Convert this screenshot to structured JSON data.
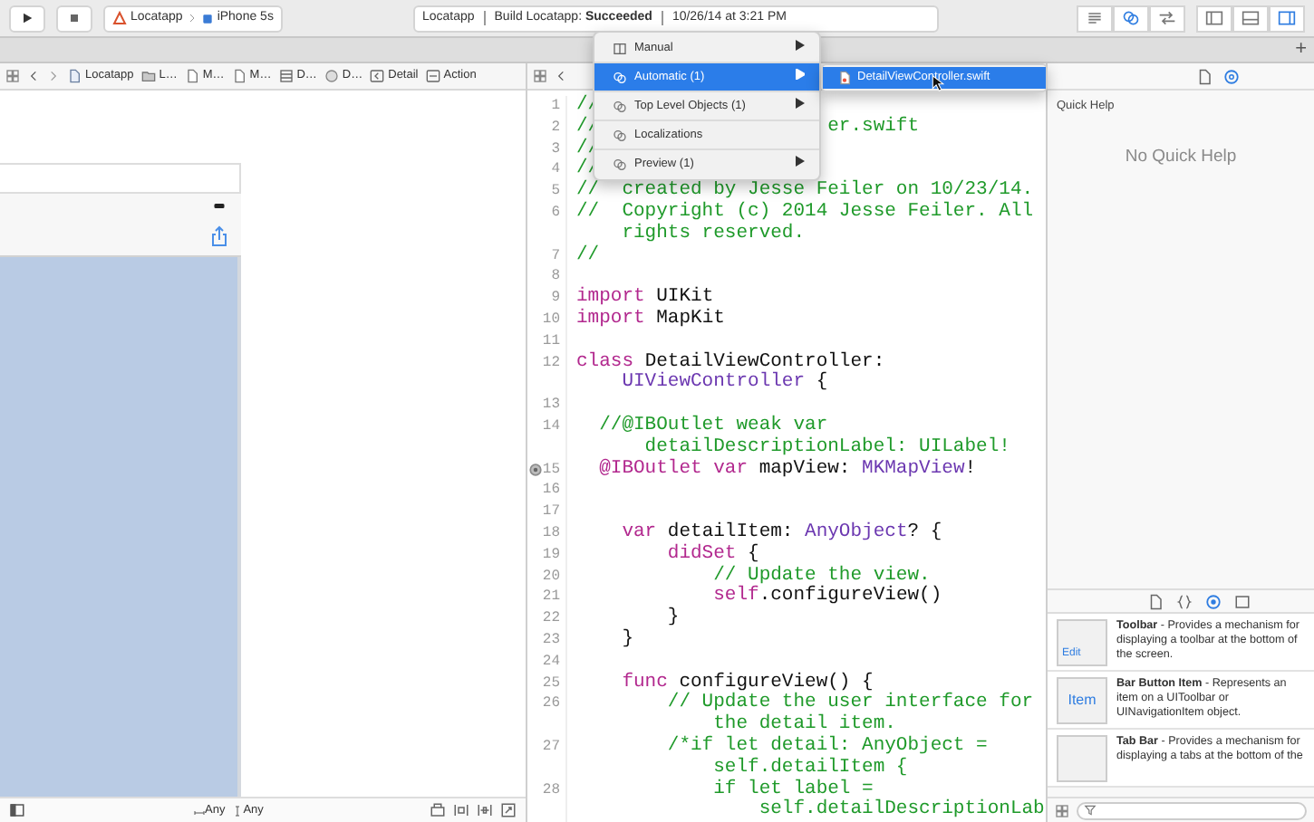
{
  "toolbar": {
    "scheme": {
      "project": "Locatapp",
      "device": "iPhone 5s"
    },
    "activity": {
      "project": "Locatapp",
      "build": "Build Locatapp: **Succeeded**",
      "timestamp": "10/26/14 at 3:21 PM"
    },
    "editor_modes": [
      {
        "kind": "standard",
        "selected": false
      },
      {
        "kind": "assistant",
        "selected": true
      },
      {
        "kind": "version",
        "selected": false
      }
    ],
    "panels": [
      {
        "kind": "navigator",
        "selected": false
      },
      {
        "kind": "debug",
        "selected": false
      },
      {
        "kind": "utilities",
        "selected": true
      }
    ]
  },
  "tab_bar": {
    "add_button": "+"
  },
  "left_jump_bar": {
    "items": [
      {
        "kind": "project",
        "text": "Locatapp"
      },
      {
        "kind": "folder",
        "text": "L…"
      },
      {
        "kind": "file",
        "text": "M…"
      },
      {
        "kind": "file",
        "text": "M…"
      },
      {
        "kind": "storyboard",
        "text": "D…"
      },
      {
        "kind": "scene",
        "text": "D…"
      },
      {
        "kind": "back",
        "text": "Detail"
      },
      {
        "kind": "button",
        "text": "Action"
      }
    ]
  },
  "canvas": {
    "size_class": {
      "width": "Any",
      "height": "Any"
    }
  },
  "related_menu": {
    "items": [
      {
        "kind": "split",
        "text": "Manual",
        "submenu": true,
        "selected": false
      },
      {
        "kind": "rings",
        "text": "Automatic (1)",
        "submenu": true,
        "selected": true
      },
      {
        "kind": "rings",
        "text": "Top Level Objects (1)",
        "submenu": true,
        "selected": false
      },
      {
        "kind": "rings",
        "text": "Localizations",
        "submenu": false,
        "selected": false
      },
      {
        "kind": "rings",
        "text": "Preview (1)",
        "submenu": true,
        "selected": false
      }
    ],
    "submenu": [
      {
        "text": "DetailViewController.swift",
        "selected": true
      }
    ]
  },
  "editor": {
    "rows": [
      {
        "number": "1",
        "segments": [
          {
            "kind": "comment",
            "text": "//"
          }
        ]
      },
      {
        "number": "2",
        "covered": true,
        "segments": [
          {
            "kind": "comment",
            "text": "//"
          },
          {
            "kind": "comment",
            "text": "er.swift"
          }
        ]
      },
      {
        "number": "3",
        "segments": [
          {
            "kind": "comment",
            "text": "//"
          }
        ]
      },
      {
        "number": "4",
        "segments": [
          {
            "kind": "comment",
            "text": "//"
          }
        ]
      },
      {
        "number": "5",
        "segments": [
          {
            "kind": "comment",
            "text": "//  created by Jesse Feiler on 10/23/14."
          }
        ]
      },
      {
        "number": "6",
        "segments": [
          {
            "kind": "comment",
            "text": "//  Copyright (c) 2014 Jesse Feiler. All"
          }
        ]
      },
      {
        "segments": [
          {
            "kind": "comment",
            "text": "    rights reserved."
          }
        ]
      },
      {
        "number": "7",
        "segments": [
          {
            "kind": "comment",
            "text": "//"
          }
        ]
      },
      {
        "number": "8"
      },
      {
        "number": "9",
        "segments": [
          {
            "kind": "keyword",
            "text": "import"
          },
          {
            "kind": "plain",
            "text": " UIKit"
          }
        ]
      },
      {
        "number": "10",
        "segments": [
          {
            "kind": "keyword",
            "text": "import"
          },
          {
            "kind": "plain",
            "text": " MapKit"
          }
        ]
      },
      {
        "number": "11"
      },
      {
        "number": "12",
        "segments": [
          {
            "kind": "keyword",
            "text": "class"
          },
          {
            "kind": "plain",
            "text": " DetailViewController:"
          }
        ]
      },
      {
        "segments": [
          {
            "kind": "type",
            "text": "    UIViewController"
          },
          {
            "kind": "plain",
            "text": " {"
          }
        ]
      },
      {
        "number": "13"
      },
      {
        "number": "14",
        "segments": [
          {
            "kind": "comment",
            "text": "  //@IBOutlet weak var"
          }
        ]
      },
      {
        "segments": [
          {
            "kind": "comment",
            "text": "      detailDescriptionLabel: UILabel!"
          }
        ]
      },
      {
        "number": "15",
        "outlet": true,
        "segments": [
          {
            "kind": "keyword",
            "text": "  @IBOutlet var"
          },
          {
            "kind": "plain",
            "text": " mapView: "
          },
          {
            "kind": "type",
            "text": "MKMapView"
          },
          {
            "kind": "plain",
            "text": "!"
          }
        ]
      },
      {
        "number": "16"
      },
      {
        "number": "17"
      },
      {
        "number": "18",
        "segments": [
          {
            "kind": "keyword",
            "text": "    var"
          },
          {
            "kind": "plain",
            "text": " detailItem: "
          },
          {
            "kind": "type",
            "text": "AnyObject"
          },
          {
            "kind": "plain",
            "text": "? {"
          }
        ]
      },
      {
        "number": "19",
        "segments": [
          {
            "kind": "keyword",
            "text": "        didSet"
          },
          {
            "kind": "plain",
            "text": " {"
          }
        ]
      },
      {
        "number": "20",
        "segments": [
          {
            "kind": "comment",
            "text": "            // Update the view."
          }
        ]
      },
      {
        "number": "21",
        "segments": [
          {
            "kind": "keyword",
            "text": "            self"
          },
          {
            "kind": "plain",
            "text": ".configureView()"
          }
        ]
      },
      {
        "number": "22",
        "segments": [
          {
            "kind": "plain",
            "text": "        }"
          }
        ]
      },
      {
        "number": "23",
        "segments": [
          {
            "kind": "plain",
            "text": "    }"
          }
        ]
      },
      {
        "number": "24"
      },
      {
        "number": "25",
        "segments": [
          {
            "kind": "keyword",
            "text": "    func"
          },
          {
            "kind": "plain",
            "text": " configureView() {"
          }
        ]
      },
      {
        "number": "26",
        "segments": [
          {
            "kind": "comment",
            "text": "        // Update the user interface for"
          }
        ]
      },
      {
        "segments": [
          {
            "kind": "comment",
            "text": "            the detail item."
          }
        ]
      },
      {
        "number": "27",
        "segments": [
          {
            "kind": "comment",
            "text": "        /*if let detail: AnyObject ="
          }
        ]
      },
      {
        "segments": [
          {
            "kind": "comment",
            "text": "            self.detailItem {"
          }
        ]
      },
      {
        "number": "28",
        "segments": [
          {
            "kind": "comment",
            "text": "            if let label ="
          }
        ]
      },
      {
        "segments": [
          {
            "kind": "comment",
            "text": "                self.detailDescriptionLab"
          }
        ]
      }
    ]
  },
  "inspector": {
    "tabs": [
      {
        "kind": "file",
        "selected": false
      },
      {
        "kind": "help",
        "selected": true
      }
    ],
    "section_title": "Quick Help",
    "empty_message": "No Quick Help"
  },
  "library": {
    "tabs": [
      {
        "kind": "file",
        "selected": false
      },
      {
        "kind": "code",
        "selected": false
      },
      {
        "kind": "object",
        "selected": true
      },
      {
        "kind": "media",
        "selected": false
      }
    ],
    "items": [
      {
        "kind": "toolbar",
        "icon_text": "Edit",
        "description": "**Toolbar** - Provides a mechanism for displaying a toolbar at the bottom of the screen."
      },
      {
        "kind": "bar_button",
        "icon_text": "Item",
        "description": "**Bar Button Item** - Represents an item on a UIToolbar or UINavigationItem object."
      },
      {
        "kind": "tab_bar",
        "description": "**Tab Bar** - Provides a mechanism for displaying a tabs at the bottom of the"
      }
    ]
  }
}
